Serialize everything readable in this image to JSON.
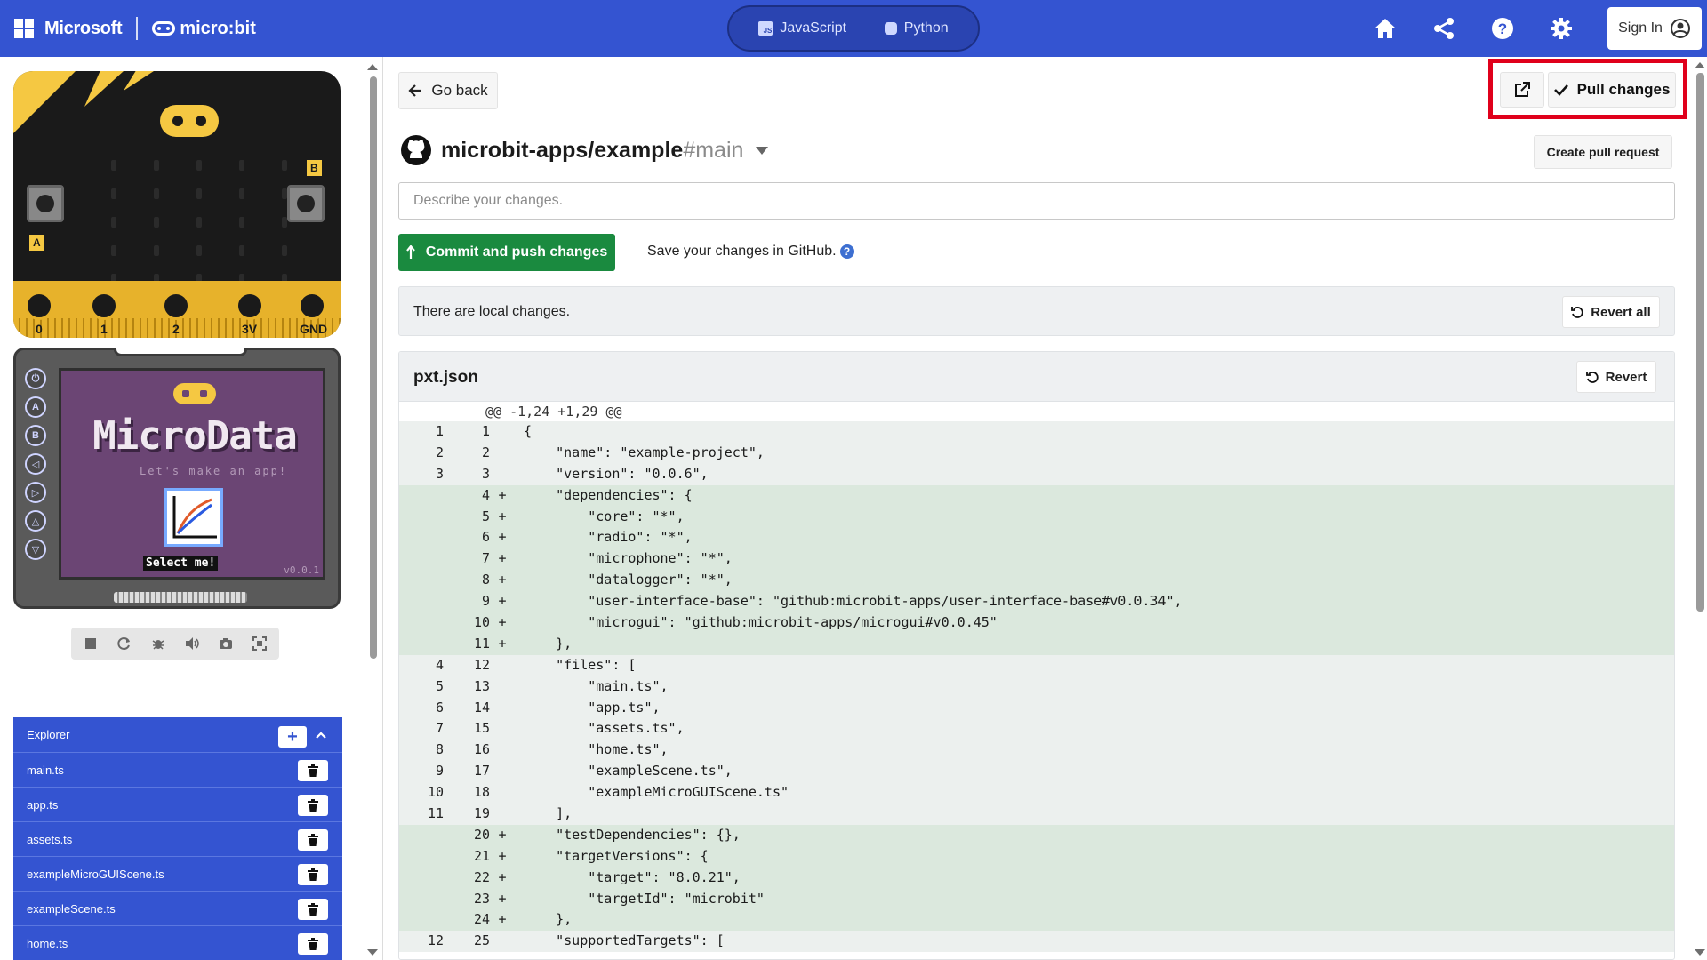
{
  "header": {
    "microsoft": "Microsoft",
    "microbit": "micro:bit",
    "lang_js": "JavaScript",
    "lang_py": "Python",
    "signin": "Sign In",
    "bar_color": "#3454d1"
  },
  "simulator": {
    "pins": [
      "0",
      "1",
      "2",
      "3V",
      "GND"
    ],
    "button_a": "A",
    "button_b": "B",
    "game_title": "MicroData",
    "game_subtitle": "Let's make an app!",
    "game_select": "Select me!",
    "game_version": "v0.0.1",
    "side_buttons": [
      "A",
      "B"
    ]
  },
  "explorer": {
    "title": "Explorer",
    "add": "+",
    "files": [
      "main.ts",
      "app.ts",
      "assets.ts",
      "exampleMicroGUIScene.ts",
      "exampleScene.ts",
      "home.ts"
    ]
  },
  "git": {
    "go_back": "Go back",
    "pull_changes": "Pull changes",
    "repo_name": "microbit-apps/example",
    "branch": "#main",
    "create_pr": "Create pull request",
    "desc_placeholder": "Describe your changes.",
    "commit_button": "Commit and push changes",
    "save_note": "Save your changes in GitHub.",
    "help": "?",
    "local_changes": "There are local changes.",
    "revert_all": "Revert all",
    "file_name": "pxt.json",
    "revert": "Revert",
    "hunk": "@@ -1,24 +1,29 @@",
    "lines": [
      {
        "o": "1",
        "n": "1",
        "m": "",
        "t": "same",
        "c": "{"
      },
      {
        "o": "2",
        "n": "2",
        "m": "",
        "t": "same",
        "c": "    \"name\": \"example-project\","
      },
      {
        "o": "3",
        "n": "3",
        "m": "",
        "t": "same",
        "c": "    \"version\": \"0.0.6\","
      },
      {
        "o": "",
        "n": "4",
        "m": "+",
        "t": "add",
        "c": "    \"dependencies\": {"
      },
      {
        "o": "",
        "n": "5",
        "m": "+",
        "t": "add",
        "c": "        \"core\": \"*\","
      },
      {
        "o": "",
        "n": "6",
        "m": "+",
        "t": "add",
        "c": "        \"radio\": \"*\","
      },
      {
        "o": "",
        "n": "7",
        "m": "+",
        "t": "add",
        "c": "        \"microphone\": \"*\","
      },
      {
        "o": "",
        "n": "8",
        "m": "+",
        "t": "add",
        "c": "        \"datalogger\": \"*\","
      },
      {
        "o": "",
        "n": "9",
        "m": "+",
        "t": "add",
        "c": "        \"user-interface-base\": \"github:microbit-apps/user-interface-base#v0.0.34\","
      },
      {
        "o": "",
        "n": "10",
        "m": "+",
        "t": "add",
        "c": "        \"microgui\": \"github:microbit-apps/microgui#v0.0.45\""
      },
      {
        "o": "",
        "n": "11",
        "m": "+",
        "t": "add",
        "c": "    },"
      },
      {
        "o": "4",
        "n": "12",
        "m": "",
        "t": "same",
        "c": "    \"files\": ["
      },
      {
        "o": "5",
        "n": "13",
        "m": "",
        "t": "same",
        "c": "        \"main.ts\","
      },
      {
        "o": "6",
        "n": "14",
        "m": "",
        "t": "same",
        "c": "        \"app.ts\","
      },
      {
        "o": "7",
        "n": "15",
        "m": "",
        "t": "same",
        "c": "        \"assets.ts\","
      },
      {
        "o": "8",
        "n": "16",
        "m": "",
        "t": "same",
        "c": "        \"home.ts\","
      },
      {
        "o": "9",
        "n": "17",
        "m": "",
        "t": "same",
        "c": "        \"exampleScene.ts\","
      },
      {
        "o": "10",
        "n": "18",
        "m": "",
        "t": "same",
        "c": "        \"exampleMicroGUIScene.ts\""
      },
      {
        "o": "11",
        "n": "19",
        "m": "",
        "t": "same",
        "c": "    ],"
      },
      {
        "o": "",
        "n": "20",
        "m": "+",
        "t": "add",
        "c": "    \"testDependencies\": {},"
      },
      {
        "o": "",
        "n": "21",
        "m": "+",
        "t": "add",
        "c": "    \"targetVersions\": {"
      },
      {
        "o": "",
        "n": "22",
        "m": "+",
        "t": "add",
        "c": "        \"target\": \"8.0.21\","
      },
      {
        "o": "",
        "n": "23",
        "m": "+",
        "t": "add",
        "c": "        \"targetId\": \"microbit\""
      },
      {
        "o": "",
        "n": "24",
        "m": "+",
        "t": "add",
        "c": "    },"
      },
      {
        "o": "12",
        "n": "25",
        "m": "",
        "t": "same",
        "c": "    \"supportedTargets\": ["
      }
    ]
  },
  "colors": {
    "accent": "#3454d1",
    "commit_green": "#1a8a3f",
    "highlight_red": "#e0001b",
    "added_line_bg": "#dbe8dd"
  }
}
